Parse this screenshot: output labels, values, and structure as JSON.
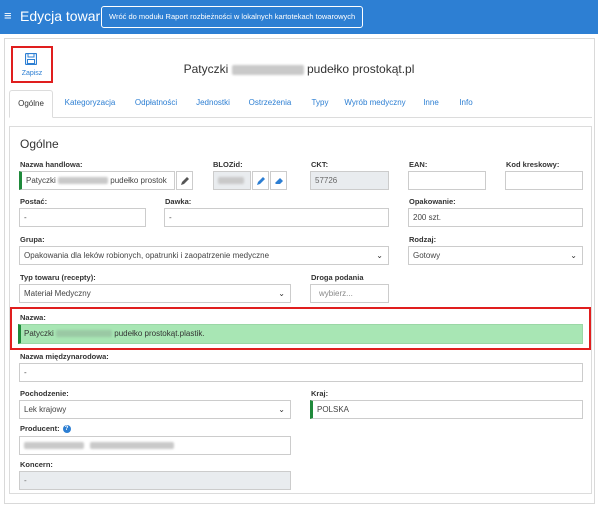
{
  "header": {
    "app_title": "Edycja towaru",
    "back_button": "Wróć do modułu Raport rozbieżności w lokalnych kartotekach towarowych"
  },
  "toolbar": {
    "save_label": "Zapisz"
  },
  "product": {
    "title_prefix": "Patyczki",
    "title_suffix": "pudełko prostokąt.pl"
  },
  "tabs": [
    "Ogólne",
    "Kategoryzacja",
    "Odpłatności",
    "Jednostki",
    "Ostrzeżenia",
    "Typy",
    "Wyrób medyczny",
    "Inne",
    "Info"
  ],
  "section_title": "Ogólne",
  "fields": {
    "nazwa_handlowa": {
      "label": "Nazwa handlowa:",
      "value_prefix": "Patyczki",
      "value_suffix": "pudełko prostok"
    },
    "blozid": {
      "label": "BLOZid:"
    },
    "ckt": {
      "label": "CKT:",
      "value": "57726"
    },
    "ean": {
      "label": "EAN:",
      "value": ""
    },
    "kod_kreskowy": {
      "label": "Kod kreskowy:",
      "value": ""
    },
    "postac": {
      "label": "Postać:",
      "value": "-"
    },
    "dawka": {
      "label": "Dawka:",
      "value": "-"
    },
    "opakowanie": {
      "label": "Opakowanie:",
      "value": "200 szt."
    },
    "grupa": {
      "label": "Grupa:",
      "value": "Opakowania dla leków robionych, opatrunki i zaopatrzenie medyczne"
    },
    "rodzaj": {
      "label": "Rodzaj:",
      "value": "Gotowy"
    },
    "typ_towaru": {
      "label": "Typ towaru (recepty):",
      "value": "Materiał Medyczny"
    },
    "droga_podania": {
      "label": "Droga podania",
      "placeholder": "wybierz..."
    },
    "nazwa": {
      "label": "Nazwa:",
      "value_prefix": "Patyczki",
      "value_suffix": "pudełko prostokąt.plastik."
    },
    "nazwa_miedzynarodowa": {
      "label": "Nazwa międzynarodowa:",
      "value": "-"
    },
    "pochodzenie": {
      "label": "Pochodzenie:",
      "value": "Lek krajowy"
    },
    "kraj": {
      "label": "Kraj:",
      "value": "POLSKA"
    },
    "producent": {
      "label": "Producent:"
    },
    "koncern": {
      "label": "Koncern:",
      "value": "-"
    }
  },
  "icons": {
    "menu": "menu-icon",
    "save": "floppy-disk-icon",
    "edit": "pencil-icon",
    "eraser": "eraser-icon",
    "dropdown": "chevron-down-icon",
    "help": "question-circle-icon"
  },
  "colors": {
    "primary": "#2d7fd3",
    "highlight_border": "#e01e1e",
    "valid_green": "#1f8a3b",
    "nazwa_bg": "#a8e6b4"
  }
}
